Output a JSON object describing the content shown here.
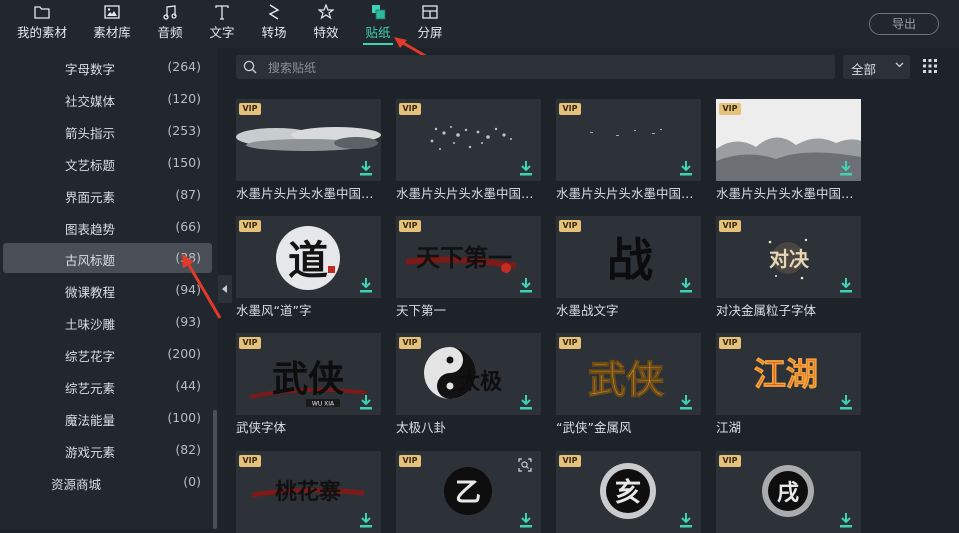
{
  "toolbar": {
    "items": [
      {
        "label": "我的素材",
        "icon": "folder-icon"
      },
      {
        "label": "素材库",
        "icon": "image-library-icon"
      },
      {
        "label": "音频",
        "icon": "music-note-icon"
      },
      {
        "label": "文字",
        "icon": "text-t-icon"
      },
      {
        "label": "转场",
        "icon": "transition-icon"
      },
      {
        "label": "特效",
        "icon": "star-effect-icon"
      },
      {
        "label": "贴纸",
        "icon": "sticker-icon",
        "active": true
      },
      {
        "label": "分屏",
        "icon": "split-screen-icon"
      }
    ],
    "export_label": "导出",
    "accent": "#3fd2b4"
  },
  "sidebar": {
    "items": [
      {
        "label": "字母数字",
        "count": "(264)"
      },
      {
        "label": "社交媒体",
        "count": "(120)"
      },
      {
        "label": "箭头指示",
        "count": "(253)"
      },
      {
        "label": "文艺标题",
        "count": "(150)"
      },
      {
        "label": "界面元素",
        "count": "(87)"
      },
      {
        "label": "图表趋势",
        "count": "(66)"
      },
      {
        "label": "古风标题",
        "count": "(38)",
        "selected": true
      },
      {
        "label": "微课教程",
        "count": "(94)"
      },
      {
        "label": "土味沙雕",
        "count": "(93)"
      },
      {
        "label": "综艺花字",
        "count": "(200)"
      },
      {
        "label": "综艺元素",
        "count": "(44)"
      },
      {
        "label": "魔法能量",
        "count": "(100)"
      },
      {
        "label": "游戏元素",
        "count": "(82)"
      },
      {
        "label": "资源商城",
        "count": "(0)",
        "top_level": true
      }
    ]
  },
  "search": {
    "placeholder": "搜索贴纸",
    "value": ""
  },
  "filter": {
    "selected": "全部"
  },
  "stickers": [
    {
      "label": "水墨片头片头水墨中国风大气",
      "vip": "VIP"
    },
    {
      "label": "水墨片头片头水墨中国风大气",
      "vip": "VIP"
    },
    {
      "label": "水墨片头片头水墨中国风大气",
      "vip": "VIP"
    },
    {
      "label": "水墨片头片头水墨中国风大气",
      "vip": "VIP"
    },
    {
      "label": "水墨风“道”字",
      "vip": "VIP",
      "glyph": "道"
    },
    {
      "label": "天下第一",
      "vip": "VIP",
      "glyph": "天下第一"
    },
    {
      "label": "水墨战文字",
      "vip": "VIP",
      "glyph": "战"
    },
    {
      "label": "对决金属粒子字体",
      "vip": "VIP",
      "glyph": "对决"
    },
    {
      "label": "武侠字体",
      "vip": "VIP",
      "glyph": "武侠",
      "sub": "WU XIA"
    },
    {
      "label": "太极八卦",
      "vip": "VIP",
      "glyph": "太极"
    },
    {
      "label": "“武侠”金属风",
      "vip": "VIP",
      "glyph": "武侠"
    },
    {
      "label": "江湖",
      "vip": "VIP",
      "glyph": "江湖"
    },
    {
      "label": "",
      "vip": "VIP",
      "glyph": "桃花寨"
    },
    {
      "label": "",
      "vip": "VIP",
      "glyph": "乙"
    },
    {
      "label": "",
      "vip": "VIP",
      "glyph": "亥"
    },
    {
      "label": "",
      "vip": "VIP",
      "glyph": "戌"
    }
  ]
}
